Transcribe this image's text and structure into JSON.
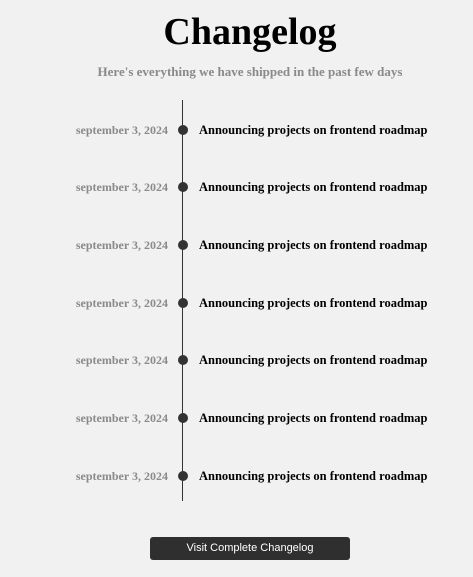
{
  "header": {
    "title": "Changelog",
    "subtitle": "Here's everything we have shipped in the past few days"
  },
  "timeline": {
    "entries": [
      {
        "date": "september 3, 2024",
        "title": "Announcing projects on frontend roadmap"
      },
      {
        "date": "september 3, 2024",
        "title": "Announcing projects on frontend roadmap"
      },
      {
        "date": "september 3, 2024",
        "title": "Announcing projects on frontend roadmap"
      },
      {
        "date": "september 3, 2024",
        "title": "Announcing projects on frontend roadmap"
      },
      {
        "date": "september 3, 2024",
        "title": "Announcing projects on frontend roadmap"
      },
      {
        "date": "september 3, 2024",
        "title": "Announcing projects on frontend roadmap"
      },
      {
        "date": "september 3, 2024",
        "title": "Announcing projects on frontend roadmap"
      }
    ]
  },
  "footer": {
    "button_label": "Visit Complete Changelog"
  },
  "colors": {
    "background": "#f1f1f1",
    "muted_text": "#8a8a8a",
    "timeline": "#333333",
    "button": "#2f2f2f"
  }
}
